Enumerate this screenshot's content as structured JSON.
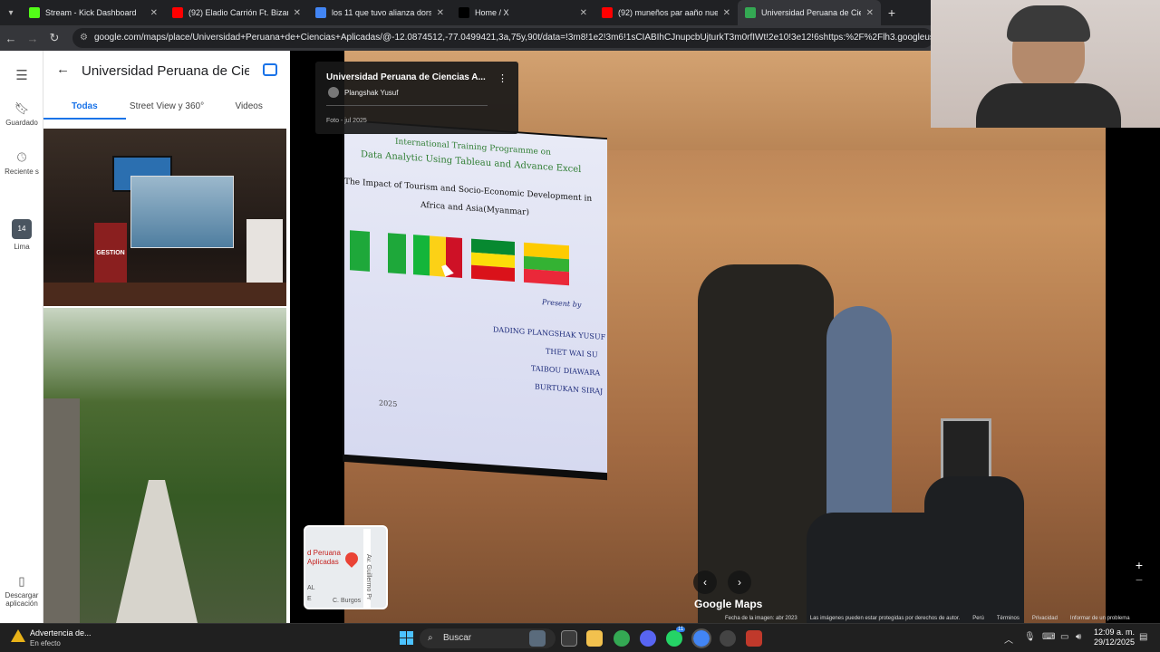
{
  "browser": {
    "tabs": [
      {
        "title": "Stream - Kick Dashboard",
        "icon": "kick-icon",
        "color": "#53fc18",
        "active": false
      },
      {
        "title": "(92) Eladio Carrión Ft. Bizarrap",
        "icon": "youtube-icon",
        "color": "#ff0000",
        "active": false
      },
      {
        "title": "los 11 que tuvo alianza dorsales",
        "icon": "google-icon",
        "color": "#4285f4",
        "active": false
      },
      {
        "title": "Home / X",
        "icon": "x-icon",
        "color": "#000000",
        "active": false
      },
      {
        "title": "(92) muneños par aaño nuevo",
        "icon": "youtube-icon",
        "color": "#ff0000",
        "active": false
      },
      {
        "title": "Universidad Peruana de Ciencias",
        "icon": "maps-pin-icon",
        "color": "#34a853",
        "active": true
      }
    ],
    "new_tab": "+",
    "url": "google.com/maps/place/Universidad+Peruana+de+Ciencias+Aplicadas/@-12.0874512,-77.0499421,3a,75y,90t/data=!3m8!1e2!3m6!1sCIABIhCJnupcbUjturkT3m0rfIWt!2e10!3e12!6shttps:%2F%2Flh3.googleusercontent.com%2"
  },
  "rail": {
    "items": [
      {
        "label": "Guardado",
        "icon": "bookmark-icon"
      },
      {
        "label": "Reciente s",
        "icon": "history-icon"
      },
      {
        "label": "Lima",
        "icon": "city-thumb-icon",
        "badge": "14"
      },
      {
        "label": "Descargar aplicación",
        "icon": "phone-icon"
      }
    ]
  },
  "panel": {
    "title": "Universidad Peruana de Cien...",
    "tabs": [
      "Todas",
      "Street View y 360°",
      "Videos"
    ],
    "active_tab": "Todas",
    "photo1_text": "GESTION"
  },
  "viewer": {
    "card": {
      "title": "Universidad Peruana de Ciencias A...",
      "author": "Plangshak Yusuf",
      "date": "Foto - jul 2025"
    },
    "slide": {
      "line1": "International Training Programme on",
      "line2": "Data Analytic Using Tableau and Advance Excel",
      "line3": "The Impact of Tourism and Socio-Economic Development in",
      "line4": "Africa and Asia(Myanmar)",
      "present": "Present by",
      "names": [
        "DADING PLANGSHAK YUSUF",
        "THET WAI SU",
        "TAIBOU DIAWARA",
        "BURTUKAN SIRAJ"
      ],
      "year": "2025"
    },
    "minimap": {
      "line1": "d Peruana",
      "line2": "Aplicadas",
      "street1": "Av. Guillermo Pr",
      "street2": "C. Burgos",
      "al": "AL",
      "e": "E"
    },
    "logo": "Google Maps",
    "footer": [
      "Fecha de la imagen: abr 2023",
      "Las imágenes pueden estar protegidas por derechos de autor.",
      "Perú",
      "Términos",
      "Privacidad",
      "Informar de un problema"
    ],
    "zoom_in": "+",
    "zoom_out": "−"
  },
  "taskbar": {
    "warning_title": "Advertencia de...",
    "warning_sub": "En efecto",
    "search": "Buscar",
    "time": "12:09 a. m.",
    "date": "29/12/2025",
    "whatsapp_badge": "11"
  }
}
